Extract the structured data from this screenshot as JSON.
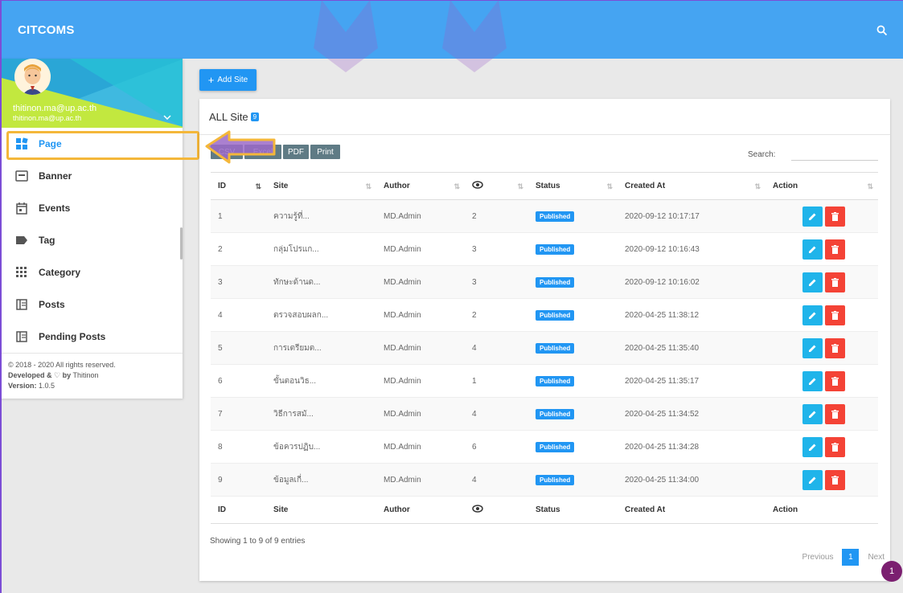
{
  "topbar": {
    "brand": "CITCOMS"
  },
  "sidebar": {
    "email_primary": "thitinon.ma@up.ac.th",
    "email_secondary": "thitinon.ma@up.ac.th",
    "items": [
      {
        "label": "Page",
        "icon": "page-icon",
        "active": true
      },
      {
        "label": "Banner",
        "icon": "banner-icon"
      },
      {
        "label": "Events",
        "icon": "calendar-icon"
      },
      {
        "label": "Tag",
        "icon": "tag-icon"
      },
      {
        "label": "Category",
        "icon": "category-grid-icon"
      },
      {
        "label": "Posts",
        "icon": "posts-icon"
      },
      {
        "label": "Pending Posts",
        "icon": "pending-posts-icon"
      }
    ],
    "footer": {
      "copyright": "© 2018 - 2020 All rights reserved.",
      "developed_prefix": "Developed & ",
      "developed_by": " by Thitinon",
      "version_label": "Version:",
      "version": "1.0.5"
    }
  },
  "main": {
    "add_button": "Add Site",
    "card_title": "ALL Site",
    "count": "9",
    "exports": [
      "CSV",
      "Excel",
      "PDF",
      "Print"
    ],
    "search_label": "Search:",
    "columns": [
      "ID",
      "Site",
      "Author",
      "",
      "Status",
      "Created At",
      "Action"
    ],
    "rows": [
      {
        "id": "1",
        "site": "ความรู้ที่...",
        "author": "MD.Admin",
        "views": "2",
        "status": "Published",
        "created": "2020-09-12 10:17:17"
      },
      {
        "id": "2",
        "site": "กลุ่มโปรแก...",
        "author": "MD.Admin",
        "views": "3",
        "status": "Published",
        "created": "2020-09-12 10:16:43"
      },
      {
        "id": "3",
        "site": "ทักษะด้านด...",
        "author": "MD.Admin",
        "views": "3",
        "status": "Published",
        "created": "2020-09-12 10:16:02"
      },
      {
        "id": "4",
        "site": "ตรวจสอบผลก...",
        "author": "MD.Admin",
        "views": "2",
        "status": "Published",
        "created": "2020-04-25 11:38:12"
      },
      {
        "id": "5",
        "site": "การเตรียมต...",
        "author": "MD.Admin",
        "views": "4",
        "status": "Published",
        "created": "2020-04-25 11:35:40"
      },
      {
        "id": "6",
        "site": "ขั้นตอนวิธ...",
        "author": "MD.Admin",
        "views": "1",
        "status": "Published",
        "created": "2020-04-25 11:35:17"
      },
      {
        "id": "7",
        "site": "วิธีการสมั...",
        "author": "MD.Admin",
        "views": "4",
        "status": "Published",
        "created": "2020-04-25 11:34:52"
      },
      {
        "id": "8",
        "site": "ข้อควรปฏิบ...",
        "author": "MD.Admin",
        "views": "6",
        "status": "Published",
        "created": "2020-04-25 11:34:28"
      },
      {
        "id": "9",
        "site": "ข้อมูลเกี่...",
        "author": "MD.Admin",
        "views": "4",
        "status": "Published",
        "created": "2020-04-25 11:34:00"
      }
    ],
    "info": "Showing 1 to 9 of 9 entries",
    "pager": {
      "prev": "Previous",
      "page": "1",
      "next": "Next"
    }
  },
  "fab_count": "1",
  "colors": {
    "primary": "#2196f3",
    "topbar": "#45a4f2",
    "danger": "#f44336",
    "highlight": "#f4b73a",
    "arrow": "#9b6ac8"
  }
}
